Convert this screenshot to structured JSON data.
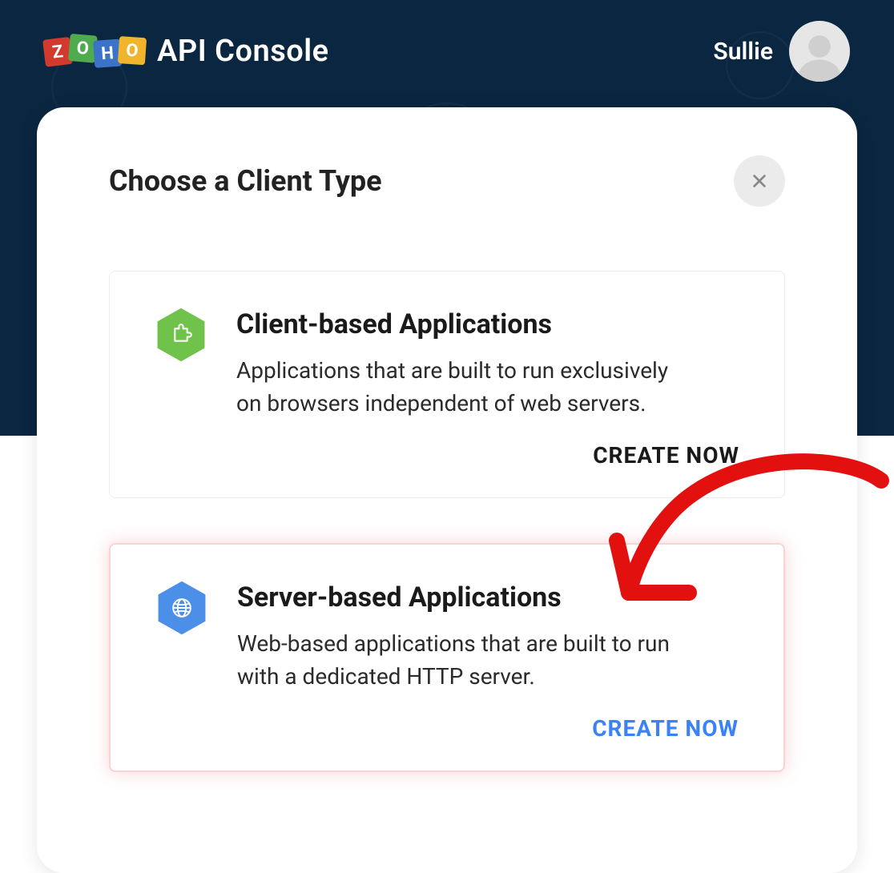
{
  "header": {
    "brand_initials": [
      "Z",
      "O",
      "H",
      "O"
    ],
    "product_name": "API Console",
    "username": "Sullie"
  },
  "modal": {
    "title": "Choose a Client Type",
    "cards": [
      {
        "title": "Client-based Applications",
        "description": "Applications that are built to run exclusively on browsers independent of web servers.",
        "action_label": "CREATE NOW",
        "icon": "puzzle-icon",
        "icon_color": "#6fc24a"
      },
      {
        "title": "Server-based Applications",
        "description": "Web-based applications that are built to run with a dedicated HTTP server.",
        "action_label": "CREATE NOW",
        "icon": "globe-icon",
        "icon_color": "#3b82f6"
      }
    ]
  },
  "annotation": {
    "arrow_color": "#e31010"
  }
}
